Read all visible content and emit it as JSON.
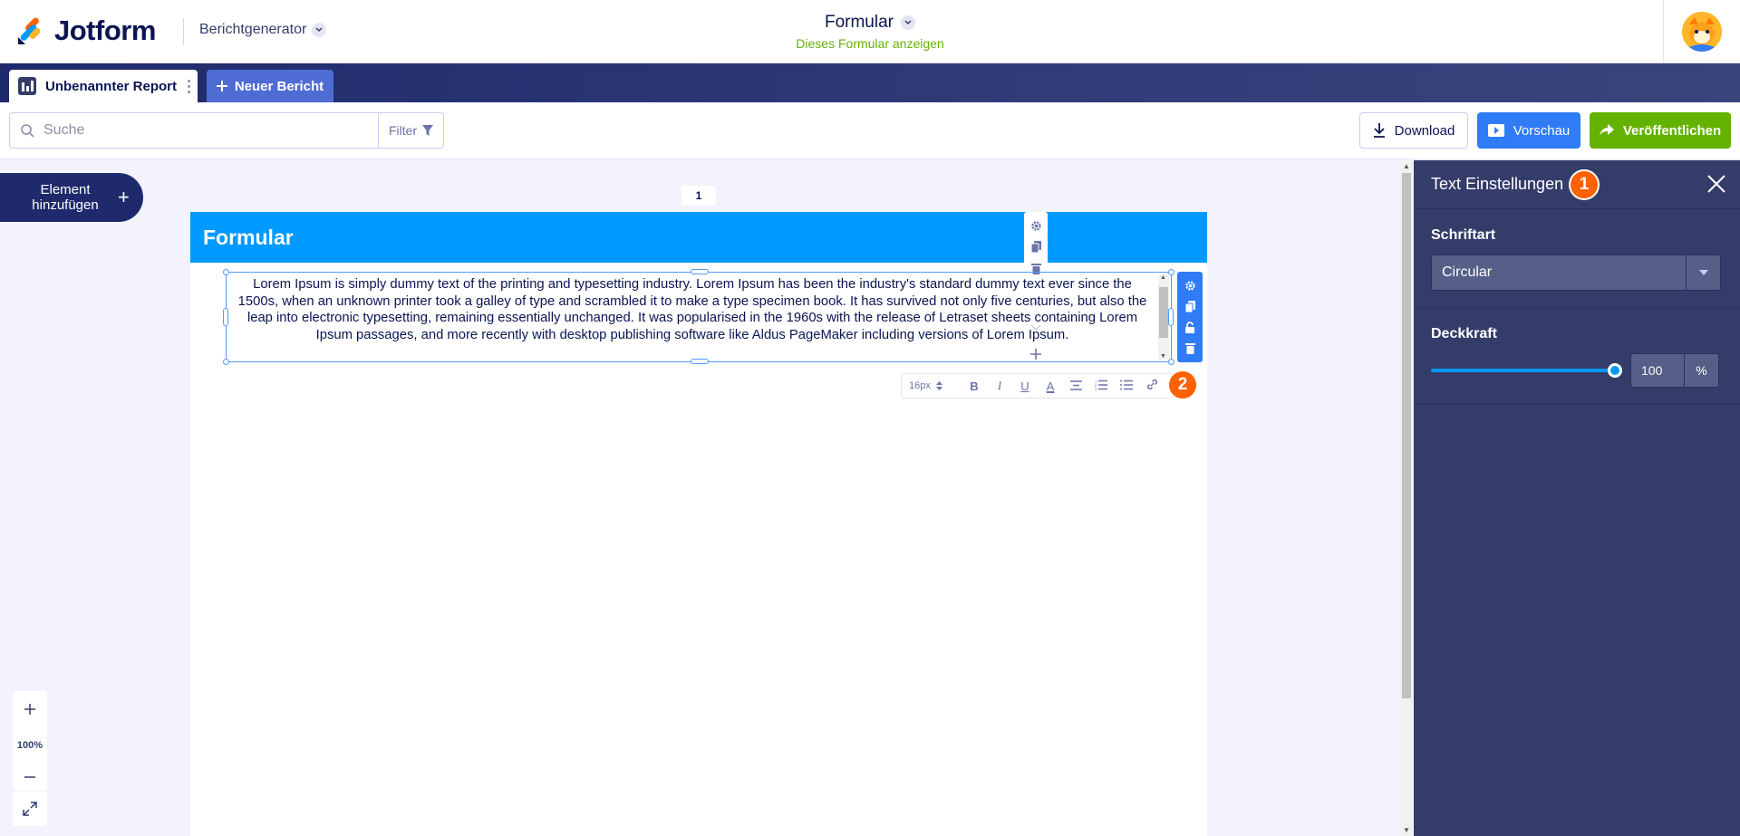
{
  "header": {
    "logo_text": "Jotform",
    "app_switcher_label": "Berichtgenerator",
    "form_title": "Formular",
    "form_link": "Dieses Formular anzeigen"
  },
  "tabs": {
    "active_label": "Unbenannter Report",
    "new_label": "Neuer Bericht"
  },
  "toolbar": {
    "search_placeholder": "Suche",
    "filter_label": "Filter",
    "download_label": "Download",
    "preview_label": "Vorschau",
    "publish_label": "Veröffentlichen"
  },
  "canvas": {
    "add_element_label": "Element hinzufügen",
    "page_number": "1",
    "page_header": "Formular",
    "text_content": "Lorem Ipsum is simply dummy text of the printing and typesetting industry. Lorem Ipsum has been the industry's standard dummy text ever since the 1500s, when an unknown printer took a galley of type and scrambled it to make a type specimen book. It has survived not only five centuries, but also the leap into electronic typesetting, remaining essentially unchanged. It was popularised in the 1960s with the release of Letraset sheets containing Lorem Ipsum passages, and more recently with desktop publishing software like Aldus PageMaker including versions of Lorem Ipsum.",
    "font_size": "16px",
    "format_buttons": [
      "B",
      "I",
      "U",
      "A"
    ],
    "zoom_level": "100%",
    "step_badge_2": "2"
  },
  "panel": {
    "title": "Text Einstellungen",
    "step_badge_1": "1",
    "font_label": "Schriftart",
    "font_value": "Circular",
    "opacity_label": "Deckkraft",
    "opacity_value": "100",
    "opacity_unit": "%",
    "opacity_level": 1.0
  },
  "colors": {
    "brand_navy": "#0a1551",
    "header_blue": "#0099ff",
    "preview_blue": "#2f7cf6",
    "publish_green": "#64b200",
    "panel_bg": "#343c6a",
    "badge_orange": "#ff6100"
  }
}
